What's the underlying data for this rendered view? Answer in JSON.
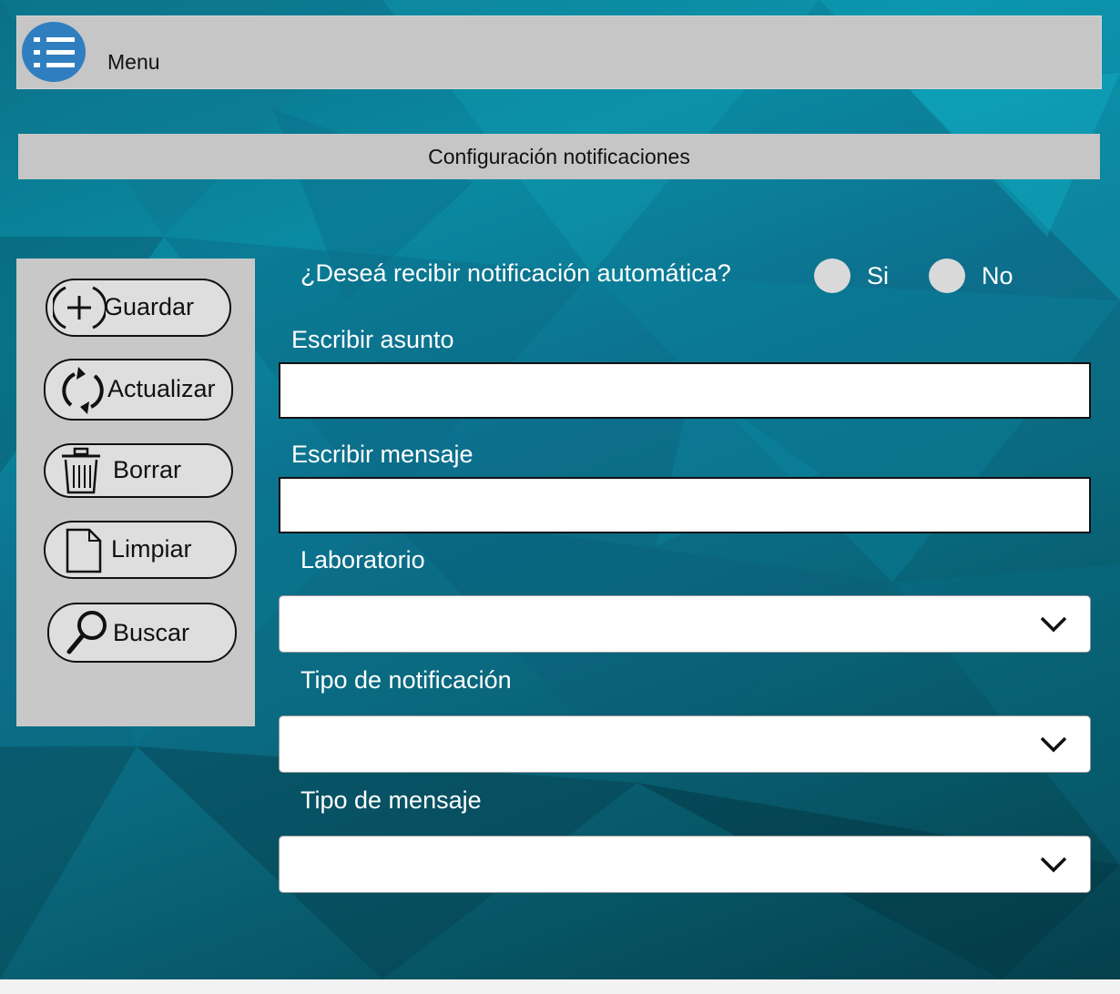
{
  "header": {
    "menu_label": "Menu",
    "menu_icon": "list-icon",
    "menu_color": "#2f7fc0"
  },
  "page": {
    "title": "Configuración notificaciones"
  },
  "actions": [
    {
      "label": "Guardar",
      "icon": "plus-circle-icon"
    },
    {
      "label": "Actualizar",
      "icon": "refresh-icon"
    },
    {
      "label": "Borrar",
      "icon": "trash-icon"
    },
    {
      "label": "Limpiar",
      "icon": "document-icon"
    },
    {
      "label": "Buscar",
      "icon": "search-icon"
    }
  ],
  "form": {
    "auto_notification_question": "¿Deseá recibir notificación automática?",
    "options": [
      {
        "label": "Si",
        "selected": false
      },
      {
        "label": "No",
        "selected": false
      }
    ],
    "subject": {
      "label": "Escribir asunto",
      "value": ""
    },
    "message": {
      "label": "Escribir mensaje",
      "value": ""
    },
    "laboratory": {
      "label": "Laboratorio",
      "value": ""
    },
    "notification_type": {
      "label": "Tipo de notificación",
      "value": ""
    },
    "message_type": {
      "label": "Tipo de mensaje",
      "value": ""
    }
  },
  "colors": {
    "panel_gray": "#c6c6c6",
    "background_teal": "#0a7f96",
    "text_white": "#ffffff"
  }
}
